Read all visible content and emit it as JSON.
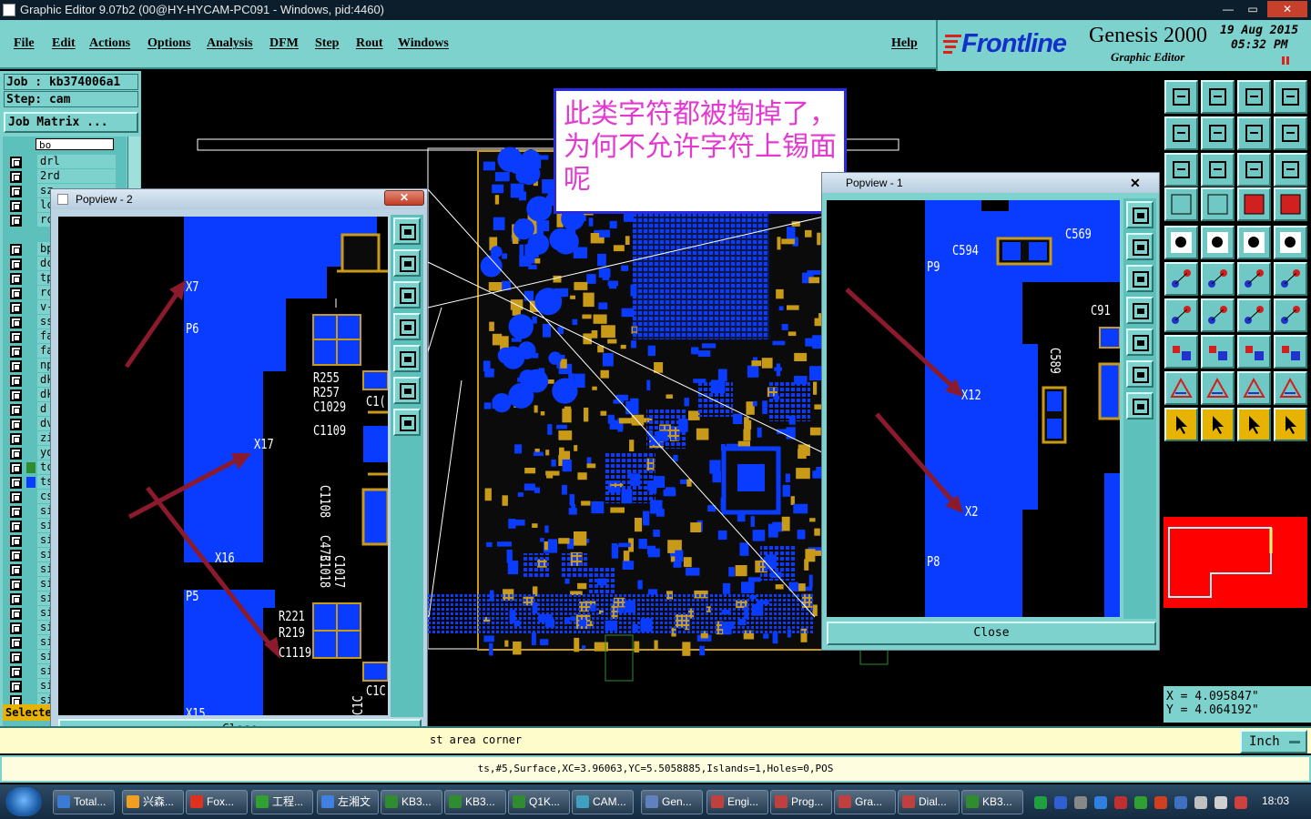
{
  "window": {
    "title": "Graphic Editor 9.07b2 (00@HY-HYCAM-PC091 - Windows, pid:4460)",
    "btn_min": "—",
    "btn_max": "▭",
    "btn_close": "✕"
  },
  "menu": {
    "file": "File",
    "edit": "Edit",
    "actions": "Actions",
    "options": "Options",
    "analysis": "Analysis",
    "dfm": "DFM",
    "step": "Step",
    "rout": "Rout",
    "windows": "Windows",
    "help": "Help"
  },
  "brand": {
    "logo": "Frontline",
    "product": "Genesis 2000",
    "subtitle": "Graphic Editor",
    "date": "19 Aug 2015",
    "time": "05:32 PM"
  },
  "job": {
    "job_label": "Job : kb374006a1",
    "step_label": "Step: cam",
    "matrix_button": "Job Matrix ..."
  },
  "layers": {
    "selector": "bo",
    "items": [
      "drl",
      "2rd",
      "sz",
      "lc",
      "rc",
      "",
      "bp",
      "dc",
      "tp",
      "rc",
      "v-",
      "ss",
      "fa",
      "fa",
      "np",
      "dk",
      "dk",
      "d",
      "dv",
      "zi",
      "yo",
      "tc",
      "ts",
      "cs",
      "si",
      "si",
      "si",
      "si",
      "si",
      "si",
      "si",
      "si",
      "si",
      "si",
      "si",
      "si",
      "si",
      "si"
    ],
    "selected_label": "Selecte"
  },
  "annotation": {
    "note": "此类字符都被掏掉了，为何不允许字符上锡面呢"
  },
  "popview2": {
    "title": "Popview - 2",
    "close_label": "Close",
    "labels": [
      "X7",
      "P6",
      "X17",
      "X16",
      "P5",
      "R255",
      "R257",
      "C1029",
      "C1109",
      "C1108",
      "C473",
      "C1017",
      "C1018",
      "R221",
      "R219",
      "C1119",
      "C1(",
      "C1C",
      "X15",
      "C1C"
    ]
  },
  "popview1": {
    "title": "Popview - 1",
    "close_label": "Close",
    "labels": [
      "C594",
      "C569",
      "P9",
      "C91",
      "C589",
      "X12",
      "X2",
      "P8"
    ]
  },
  "coords": {
    "x": "X  =  4.095847\"",
    "y": "Y  =  4.064192\""
  },
  "status": {
    "message": "st area corner",
    "units": "Inch",
    "info": "ts,#5,Surface,XC=3.96063,YC=5.5058885,Islands=1,Holes=0,POS"
  },
  "taskbar": {
    "items": [
      "Total...",
      "兴森...",
      "Fox...",
      "工程...",
      "左湘文",
      "KB3...",
      "KB3...",
      "Q1K...",
      "CAM...",
      "Gen...",
      "Engi...",
      "Prog...",
      "Gra...",
      "Dial...",
      "KB3..."
    ],
    "clock": "18:03"
  },
  "colors": {
    "panel": "#7dd2cd",
    "copper": "#0a3cff",
    "silk": "#c89a18",
    "annotation_text": "#e23ad0",
    "annotation_border": "#2a2ae0",
    "arrow": "#8b1a2c",
    "minimap": "#ff0000"
  }
}
